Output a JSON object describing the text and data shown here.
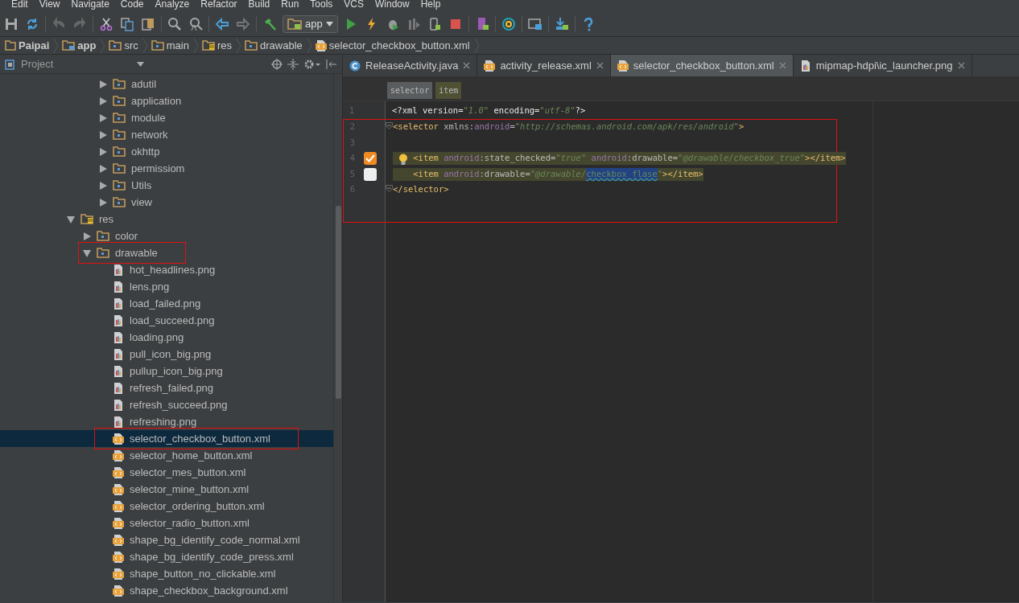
{
  "menu": [
    "Edit",
    "View",
    "Navigate",
    "Code",
    "Analyze",
    "Refactor",
    "Build",
    "Run",
    "Tools",
    "VCS",
    "Window",
    "Help"
  ],
  "toolbar": {
    "run_config": "app"
  },
  "breadcrumbs": [
    {
      "label": "Paipai",
      "kind": "project"
    },
    {
      "label": "app",
      "kind": "module"
    },
    {
      "label": "src",
      "kind": "folder"
    },
    {
      "label": "main",
      "kind": "folder"
    },
    {
      "label": "res",
      "kind": "res"
    },
    {
      "label": "drawable",
      "kind": "package"
    },
    {
      "label": "selector_checkbox_button.xml",
      "kind": "xml"
    }
  ],
  "project_panel": {
    "title": "Project",
    "package_folders": [
      {
        "label": "adutil",
        "expanded": false
      },
      {
        "label": "application",
        "expanded": false
      },
      {
        "label": "module",
        "expanded": false
      },
      {
        "label": "network",
        "expanded": false
      },
      {
        "label": "okhttp",
        "expanded": false
      },
      {
        "label": "permissiom",
        "expanded": false
      },
      {
        "label": "Utils",
        "expanded": false
      },
      {
        "label": "view",
        "expanded": false
      }
    ],
    "res_folder": {
      "label": "res",
      "expanded": true,
      "children": [
        {
          "label": "color",
          "expanded": false,
          "marked": false
        },
        {
          "label": "drawable",
          "expanded": true,
          "marked": true,
          "children": [
            {
              "label": "hot_headlines.png",
              "kind": "png",
              "selected": false,
              "marked": false
            },
            {
              "label": "lens.png",
              "kind": "png",
              "selected": false,
              "marked": false
            },
            {
              "label": "load_failed.png",
              "kind": "png",
              "selected": false,
              "marked": false
            },
            {
              "label": "load_succeed.png",
              "kind": "png",
              "selected": false,
              "marked": false
            },
            {
              "label": "loading.png",
              "kind": "png",
              "selected": false,
              "marked": false
            },
            {
              "label": "pull_icon_big.png",
              "kind": "png",
              "selected": false,
              "marked": false
            },
            {
              "label": "pullup_icon_big.png",
              "kind": "png",
              "selected": false,
              "marked": false
            },
            {
              "label": "refresh_failed.png",
              "kind": "png",
              "selected": false,
              "marked": false
            },
            {
              "label": "refresh_succeed.png",
              "kind": "png",
              "selected": false,
              "marked": false
            },
            {
              "label": "refreshing.png",
              "kind": "png",
              "selected": false,
              "marked": false
            },
            {
              "label": "selector_checkbox_button.xml",
              "kind": "xml",
              "selected": true,
              "marked": true
            },
            {
              "label": "selector_home_button.xml",
              "kind": "xml",
              "selected": false,
              "marked": false
            },
            {
              "label": "selector_mes_button.xml",
              "kind": "xml",
              "selected": false,
              "marked": false
            },
            {
              "label": "selector_mine_button.xml",
              "kind": "xml",
              "selected": false,
              "marked": false
            },
            {
              "label": "selector_ordering_button.xml",
              "kind": "xml",
              "selected": false,
              "marked": false
            },
            {
              "label": "selector_radio_button.xml",
              "kind": "xml",
              "selected": false,
              "marked": false
            },
            {
              "label": "shape_bg_identify_code_normal.xml",
              "kind": "xml",
              "selected": false,
              "marked": false
            },
            {
              "label": "shape_bg_identify_code_press.xml",
              "kind": "xml",
              "selected": false,
              "marked": false
            },
            {
              "label": "shape_button_no_clickable.xml",
              "kind": "xml",
              "selected": false,
              "marked": false
            },
            {
              "label": "shape_checkbox_background.xml",
              "kind": "xml",
              "selected": false,
              "marked": false
            }
          ]
        }
      ]
    }
  },
  "tabs": [
    {
      "label": "ReleaseActivity.java",
      "kind": "java",
      "selected": false
    },
    {
      "label": "activity_release.xml",
      "kind": "xml",
      "selected": false
    },
    {
      "label": "selector_checkbox_button.xml",
      "kind": "xml",
      "selected": true
    },
    {
      "label": "mipmap-hdpi\\ic_launcher.png",
      "kind": "png",
      "selected": false
    }
  ],
  "tag_path": [
    {
      "label": "selector",
      "selected": false
    },
    {
      "label": "item",
      "selected": true
    }
  ],
  "editor": {
    "lines": [
      {
        "number": "1",
        "marked": false,
        "highlighted": false,
        "fold": false,
        "tokens": [
          {
            "text": "<?xml version=",
            "kind": "plain"
          },
          {
            "text": "\"1.0\"",
            "kind": "value"
          },
          {
            "text": " encoding=",
            "kind": "plain"
          },
          {
            "text": "\"utf-8\"",
            "kind": "value"
          },
          {
            "text": "?>",
            "kind": "plain"
          }
        ]
      },
      {
        "number": "2",
        "marked": true,
        "highlighted": false,
        "fold": true,
        "tokens": [
          {
            "text": "<selector",
            "kind": "tag"
          },
          {
            "text": " xmlns:",
            "kind": "attr"
          },
          {
            "text": "android",
            "kind": "ns"
          },
          {
            "text": "=",
            "kind": "attr"
          },
          {
            "text": "\"http://schemas.android.com/apk/res/android\"",
            "kind": "value"
          },
          {
            "text": ">",
            "kind": "tag"
          }
        ]
      },
      {
        "number": "3",
        "marked": true,
        "highlighted": false,
        "fold": false
      },
      {
        "number": "4",
        "marked": true,
        "highlighted": true,
        "fold": false,
        "hint_icon": {
          "kind": "lightbulb"
        },
        "preview": {
          "checked": true
        },
        "tokens": [
          {
            "text": "    <item ",
            "kind": "tag"
          },
          {
            "text": "android",
            "kind": "ns"
          },
          {
            "text": ":state_checked=",
            "kind": "attr"
          },
          {
            "text": "\"true\" ",
            "kind": "value"
          },
          {
            "text": "android",
            "kind": "ns"
          },
          {
            "text": ":drawable=",
            "kind": "attr"
          },
          {
            "text": "\"@drawable/checkbox_true\"",
            "kind": "value"
          },
          {
            "text": "></item>",
            "kind": "tag"
          }
        ]
      },
      {
        "number": "5",
        "marked": true,
        "highlighted": true,
        "fold": false,
        "preview": {
          "checked": false
        },
        "tokens": [
          {
            "text": "    <item ",
            "kind": "tag"
          },
          {
            "text": "android",
            "kind": "ns"
          },
          {
            "text": ":drawable=",
            "kind": "attr"
          },
          {
            "text": "\"@drawable/",
            "kind": "value"
          },
          {
            "text": "checkbox_flase",
            "kind": "selection"
          },
          {
            "text": "\"",
            "kind": "value"
          },
          {
            "text": "></item>",
            "kind": "tag"
          }
        ]
      },
      {
        "number": "6",
        "marked": true,
        "highlighted": false,
        "fold": true,
        "tokens": [
          {
            "text": "</selector>",
            "kind": "tag"
          }
        ]
      }
    ]
  }
}
